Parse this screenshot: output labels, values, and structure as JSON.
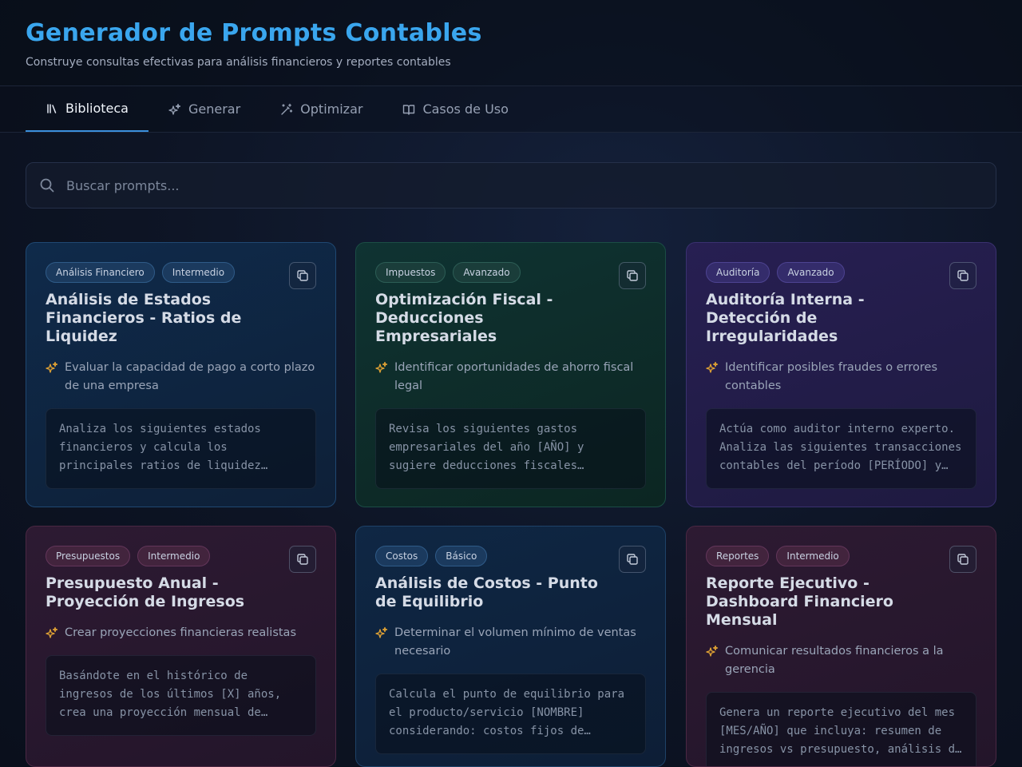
{
  "app": {
    "title": "Generador de Prompts Contables",
    "subtitle": "Construye consultas efectivas para análisis financieros y reportes contables"
  },
  "tabs": [
    {
      "label": "Biblioteca",
      "icon": "library-icon",
      "active": true
    },
    {
      "label": "Generar",
      "icon": "sparkles-icon",
      "active": false
    },
    {
      "label": "Optimizar",
      "icon": "wand-icon",
      "active": false
    },
    {
      "label": "Casos de Uso",
      "icon": "book-open-icon",
      "active": false
    }
  ],
  "search": {
    "placeholder": "Buscar prompts..."
  },
  "cards": [
    {
      "tags": [
        "Análisis Financiero",
        "Intermedio"
      ],
      "title": "Análisis de Estados Financieros - Ratios de Liquidez",
      "objective": "Evaluar la capacidad de pago a corto plazo de una empresa",
      "prompt": "Analiza los siguientes estados financieros y calcula los principales ratios de liquidez…"
    },
    {
      "tags": [
        "Impuestos",
        "Avanzado"
      ],
      "title": "Optimización Fiscal - Deducciones Empresariales",
      "objective": "Identificar oportunidades de ahorro fiscal legal",
      "prompt": "Revisa los siguientes gastos empresariales del año [AÑO] y sugiere deducciones fiscales…"
    },
    {
      "tags": [
        "Auditoría",
        "Avanzado"
      ],
      "title": "Auditoría Interna - Detección de Irregularidades",
      "objective": "Identificar posibles fraudes o errores contables",
      "prompt": "Actúa como auditor interno experto. Analiza las siguientes transacciones contables del período [PERÍODO] y…"
    },
    {
      "tags": [
        "Presupuestos",
        "Intermedio"
      ],
      "title": "Presupuesto Anual - Proyección de Ingresos",
      "objective": "Crear proyecciones financieras realistas",
      "prompt": "Basándote en el histórico de ingresos de los últimos [X] años, crea una proyección mensual de…"
    },
    {
      "tags": [
        "Costos",
        "Básico"
      ],
      "title": "Análisis de Costos - Punto de Equilibrio",
      "objective": "Determinar el volumen mínimo de ventas necesario",
      "prompt": "Calcula el punto de equilibrio para el producto/servicio [NOMBRE] considerando: costos fijos de…"
    },
    {
      "tags": [
        "Reportes",
        "Intermedio"
      ],
      "title": "Reporte Ejecutivo - Dashboard Financiero Mensual",
      "objective": "Comunicar resultados financieros a la gerencia",
      "prompt": "Genera un reporte ejecutivo del mes [MES/AÑO] que incluya: resumen de ingresos vs presupuesto, análisis d…"
    }
  ],
  "colors": {
    "title": "#3aa6ee",
    "tab_active_underline": "#3b8fdc",
    "objective_icon": "#e0a234"
  }
}
